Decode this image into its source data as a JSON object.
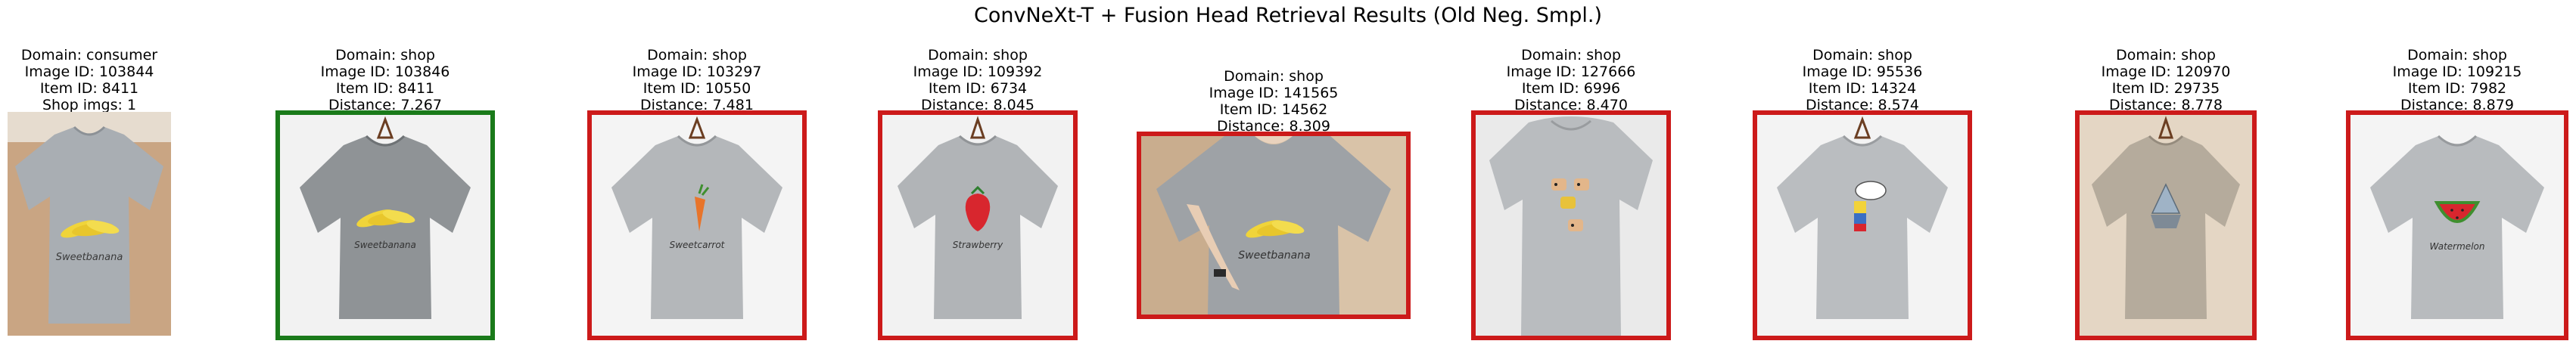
{
  "title": "ConvNeXt-T + Fusion Head Retrieval Results (Old Neg. Smpl.)",
  "colors": {
    "match": "#1a7a1a",
    "mismatch": "#cc1a1a"
  },
  "query": {
    "domain": "Domain: consumer",
    "image_id": "Image ID: 103844",
    "item_id": "Item ID: 8411",
    "extra": "Shop imgs: 1",
    "print": "Sweetbanana"
  },
  "results": [
    {
      "domain": "Domain: shop",
      "image_id": "Image ID: 103846",
      "item_id": "Item ID: 8411",
      "distance": "Distance: 7.267",
      "print": "Sweetbanana"
    },
    {
      "domain": "Domain: shop",
      "image_id": "Image ID: 103297",
      "item_id": "Item ID: 10550",
      "distance": "Distance: 7.481",
      "print": "Sweetcarrot"
    },
    {
      "domain": "Domain: shop",
      "image_id": "Image ID: 109392",
      "item_id": "Item ID: 6734",
      "distance": "Distance: 8.045",
      "print": "Strawberry"
    },
    {
      "domain": "Domain: shop",
      "image_id": "Image ID: 141565",
      "item_id": "Item ID: 14562",
      "distance": "Distance: 8.309",
      "print": "Sweetbanana"
    },
    {
      "domain": "Domain: shop",
      "image_id": "Image ID: 127666",
      "item_id": "Item ID: 6996",
      "distance": "Distance: 8.470",
      "print": ""
    },
    {
      "domain": "Domain: shop",
      "image_id": "Image ID: 95536",
      "item_id": "Item ID: 14324",
      "distance": "Distance: 8.574",
      "print": ""
    },
    {
      "domain": "Domain: shop",
      "image_id": "Image ID: 120970",
      "item_id": "Item ID: 29735",
      "distance": "Distance: 8.778",
      "print": ""
    },
    {
      "domain": "Domain: shop",
      "image_id": "Image ID: 109215",
      "item_id": "Item ID: 7982",
      "distance": "Distance: 8.879",
      "print": "Watermelon"
    }
  ]
}
